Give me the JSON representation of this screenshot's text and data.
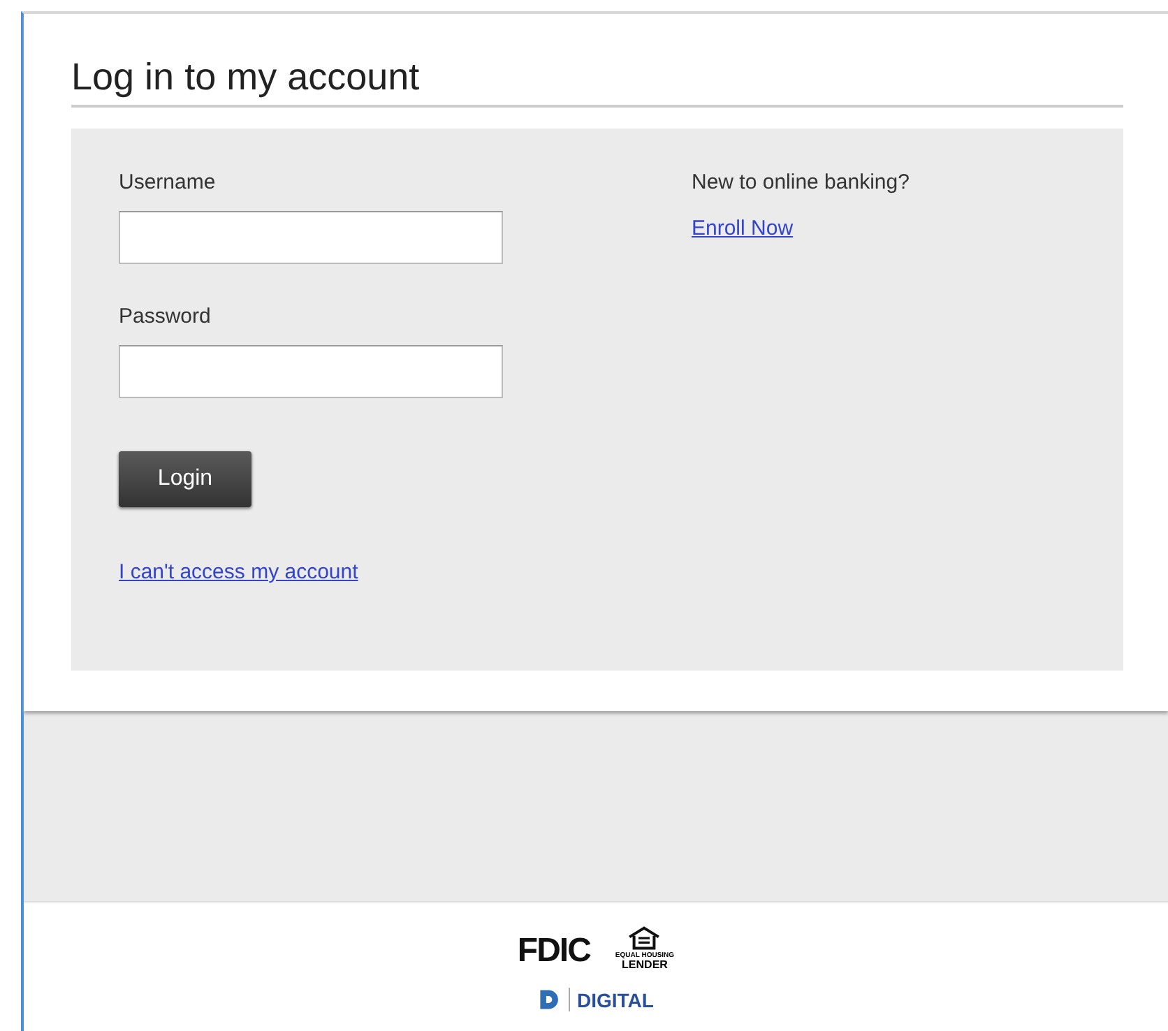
{
  "login_card": {
    "title": "Log in to my account",
    "fields": [
      {
        "label": "Username"
      },
      {
        "label": "Password"
      }
    ],
    "login_button": "Login",
    "help_link": "I can't access my account",
    "enroll": {
      "prompt": "New to online banking?",
      "link": "Enroll Now"
    }
  },
  "footer": {
    "fdic": "FDIC",
    "equal_housing": [
      "EQUAL HOUSING",
      "LENDER"
    ],
    "digital_insight": "DIGITAL"
  }
}
